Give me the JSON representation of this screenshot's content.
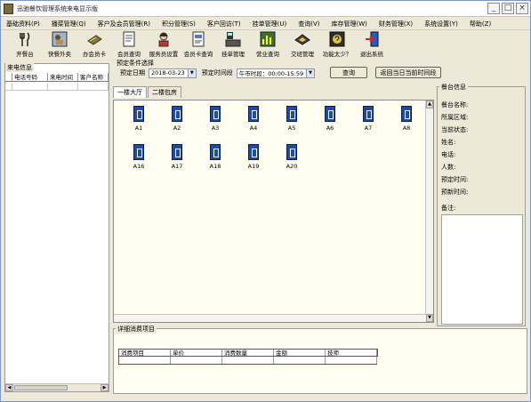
{
  "window": {
    "title": "迅驰餐饮管理系统来电显示版",
    "controls": [
      "minimize",
      "maximize",
      "close"
    ]
  },
  "menu": [
    "基础资料(P)",
    "播菜管理(Q)",
    "客户及会员管理(R)",
    "积分管理(S)",
    "客户回访(T)",
    "挂单管理(U)",
    "查询(V)",
    "库存管理(W)",
    "财务管理(X)",
    "系统设置(Y)",
    "帮助(Z)"
  ],
  "toolbar": [
    {
      "label": "开餐台",
      "icon": "cutlery-icon"
    },
    {
      "label": "快餐外卖",
      "icon": "takeout-icon"
    },
    {
      "label": "办会员卡",
      "icon": "card-icon"
    },
    {
      "label": "会员查询",
      "icon": "document-icon"
    },
    {
      "label": "服务员设置",
      "icon": "waiter-icon"
    },
    {
      "label": "会员卡查询",
      "icon": "card-search-icon"
    },
    {
      "label": "挂单管理",
      "icon": "cash-register-icon"
    },
    {
      "label": "营业查询",
      "icon": "chart-icon"
    },
    {
      "label": "交班管理",
      "icon": "shift-icon"
    },
    {
      "label": "功能太少？",
      "icon": "question-icon"
    },
    {
      "label": "退出系统",
      "icon": "exit-icon"
    }
  ],
  "caller_panel": {
    "caption": "来电信息",
    "columns": [
      "电话号码",
      "来电时间",
      "客户名称"
    ]
  },
  "booking": {
    "caption": "预定条件选择",
    "date_label": "预定日期",
    "date_value": "2018-03-23",
    "period_label": "预定时间段",
    "period_value": "午市时段：00:00-15:59",
    "query_button": "查询",
    "return_button": "返回当日当前时间段"
  },
  "tabs": [
    "一楼大厅",
    "二楼包房"
  ],
  "active_tab": 0,
  "tables": [
    "A1",
    "A2",
    "A3",
    "A4",
    "A5",
    "A6",
    "A7",
    "A8",
    "A16",
    "A17",
    "A18",
    "A19",
    "A20"
  ],
  "table_info": {
    "caption": "餐台信息",
    "fields": [
      "餐台名称:",
      "所属区域:",
      "当前状态:",
      "姓名:",
      "电话:",
      "人数:",
      "预定时间:",
      "预新时间:"
    ],
    "remark_label": "备注:"
  },
  "detail": {
    "caption": "详细消费项目",
    "columns": [
      "消费项目",
      "单价",
      "消费数量",
      "金额",
      "技师"
    ]
  },
  "colors": {
    "table_icon": "#1e4aa8",
    "area_bg": "#fffef0",
    "window_bg": "#ece9d8"
  }
}
